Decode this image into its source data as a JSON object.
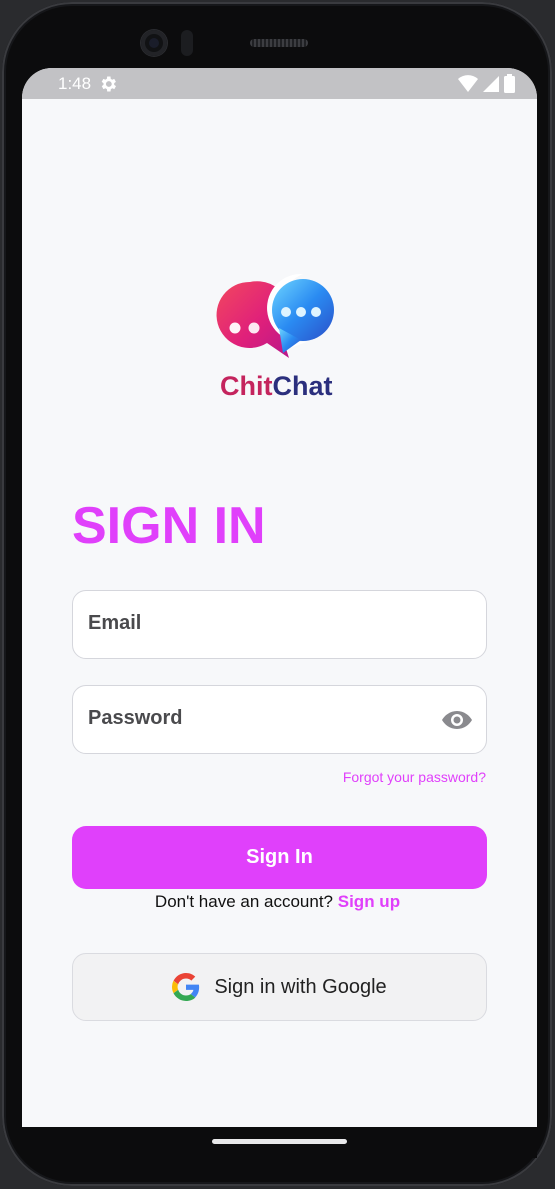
{
  "status_bar": {
    "time": "1:48"
  },
  "logo": {
    "part1": "Chit",
    "part2": "Chat"
  },
  "title": "SIGN IN",
  "form": {
    "email_label": "Email",
    "password_label": "Password",
    "forgot_link": "Forgot your password?",
    "sign_in_button": "Sign In",
    "no_account_text": "Don't have an account?",
    "sign_up_link": "Sign up",
    "google_button": "Sign in with Google"
  },
  "colors": {
    "accent": "#e040fb",
    "logo_primary": "#c4245d",
    "logo_secondary": "#2b2f7d"
  },
  "icons": [
    "settings-gear-icon",
    "wifi-icon",
    "signal-icon",
    "battery-icon",
    "eye-icon",
    "google-icon"
  ]
}
